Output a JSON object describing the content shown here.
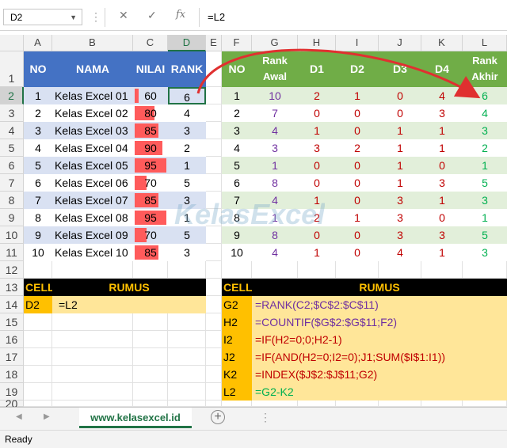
{
  "formula_bar": {
    "name_box": "D2",
    "cancel": "✕",
    "enter": "✓",
    "fx": "fx",
    "formula": "=L2"
  },
  "columns": [
    "A",
    "B",
    "C",
    "D",
    "E",
    "F",
    "G",
    "H",
    "I",
    "J",
    "K",
    "L"
  ],
  "rows": [
    "1",
    "2",
    "3",
    "4",
    "5",
    "6",
    "7",
    "8",
    "9",
    "10",
    "11",
    "12",
    "13",
    "14",
    "15",
    "16",
    "17",
    "18",
    "19",
    "20"
  ],
  "left_table": {
    "headers": [
      "NO",
      "NAMA",
      "NILAI",
      "RANK"
    ],
    "rows": [
      [
        "1",
        "Kelas Excel 01",
        "60",
        "6"
      ],
      [
        "2",
        "Kelas Excel 02",
        "80",
        "4"
      ],
      [
        "3",
        "Kelas Excel 03",
        "85",
        "3"
      ],
      [
        "4",
        "Kelas Excel 04",
        "90",
        "2"
      ],
      [
        "5",
        "Kelas Excel 05",
        "95",
        "1"
      ],
      [
        "6",
        "Kelas Excel 06",
        "70",
        "5"
      ],
      [
        "7",
        "Kelas Excel 07",
        "85",
        "3"
      ],
      [
        "8",
        "Kelas Excel 08",
        "95",
        "1"
      ],
      [
        "9",
        "Kelas Excel 09",
        "70",
        "5"
      ],
      [
        "10",
        "Kelas Excel 10",
        "85",
        "3"
      ]
    ],
    "nilai_levels": [
      60,
      80,
      85,
      90,
      95,
      70,
      85,
      95,
      70,
      85
    ]
  },
  "right_table": {
    "headers": [
      "NO",
      "Rank Awal",
      "D1",
      "D2",
      "D3",
      "D4",
      "Rank Akhir"
    ],
    "rows": [
      [
        "1",
        "10",
        "2",
        "1",
        "0",
        "4",
        "6"
      ],
      [
        "2",
        "7",
        "0",
        "0",
        "0",
        "3",
        "4"
      ],
      [
        "3",
        "4",
        "1",
        "0",
        "1",
        "1",
        "3"
      ],
      [
        "4",
        "3",
        "3",
        "2",
        "1",
        "1",
        "2"
      ],
      [
        "5",
        "1",
        "0",
        "0",
        "1",
        "0",
        "1"
      ],
      [
        "6",
        "8",
        "0",
        "0",
        "1",
        "3",
        "5"
      ],
      [
        "7",
        "4",
        "1",
        "0",
        "3",
        "1",
        "3"
      ],
      [
        "8",
        "1",
        "2",
        "1",
        "3",
        "0",
        "1"
      ],
      [
        "9",
        "8",
        "0",
        "0",
        "3",
        "3",
        "5"
      ],
      [
        "10",
        "4",
        "1",
        "0",
        "4",
        "1",
        "3"
      ]
    ]
  },
  "left_formula": {
    "header_cell": "CELL",
    "header_rumus": "RUMUS",
    "rows": [
      [
        "D2",
        "=L2"
      ]
    ]
  },
  "right_formula": {
    "header_cell": "CELL",
    "header_rumus": "RUMUS",
    "rows": [
      [
        "G2",
        "=RANK(C2;$C$2:$C$11)"
      ],
      [
        "H2",
        "=COUNTIF($G$2:$G$11;F2)"
      ],
      [
        "I2",
        "=IF(H2=0;0;H2-1)"
      ],
      [
        "J2",
        "=IF(AND(H2=0;I2=0);J1;SUM($I$1:I1))"
      ],
      [
        "K2",
        "=INDEX($J$2:$J$11;G2)"
      ],
      [
        "L2",
        "=G2-K2"
      ]
    ]
  },
  "watermark": "KelasExcel",
  "sheet_tab": "www.kelasexcel.id",
  "status": "Ready",
  "colors": {
    "blue_header": "#4472c4",
    "green_header": "#70ad47",
    "green_row": "#e2efda",
    "purple": "#7030a0",
    "red": "#c00000",
    "green_text": "#00b050",
    "yellow": "#ffe699",
    "orange": "#ffc000",
    "bar_red": "#ff5b5b"
  }
}
